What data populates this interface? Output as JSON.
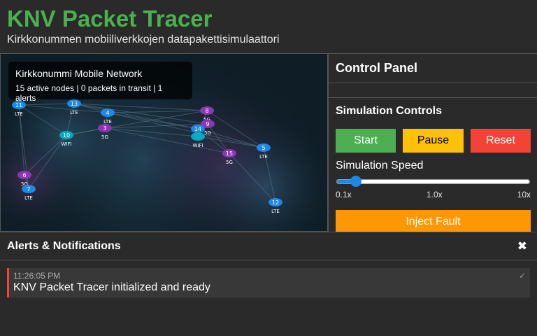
{
  "header": {
    "title": "KNV Packet Tracer",
    "subtitle": "Kirkkonummen mobiiliverkkojen datapakettisimulaattori"
  },
  "network": {
    "info_title": "Kirkkonummi Mobile Network",
    "info_stats": "15 active nodes | 0 packets in transit | 1 alerts",
    "nodes": [
      {
        "id": "11",
        "type": "LTE"
      },
      {
        "id": "13",
        "type": "LTE"
      },
      {
        "id": "4",
        "type": "LTE"
      },
      {
        "id": "3",
        "type": "5G"
      },
      {
        "id": "10",
        "type": "WIFI"
      },
      {
        "id": "8",
        "type": "5G"
      },
      {
        "id": "9",
        "type": "5G"
      },
      {
        "id": "14",
        "type": "LTE"
      },
      {
        "id": "",
        "type": "WIFI"
      },
      {
        "id": "5",
        "type": "LTE"
      },
      {
        "id": "15",
        "type": "5G"
      },
      {
        "id": "6",
        "type": "5G"
      },
      {
        "id": "7",
        "type": "LTE"
      },
      {
        "id": "12",
        "type": "LTE"
      }
    ],
    "colors": {
      "LTE": "#1e88e5",
      "5G": "#8e35b5",
      "WIFI": "#00acc1"
    }
  },
  "control_panel": {
    "title": "Control Panel",
    "simulation_title": "Simulation Controls",
    "start_label": "Start",
    "pause_label": "Pause",
    "reset_label": "Reset",
    "speed_label": "Simulation Speed",
    "speed_min": "0.1x",
    "speed_mid": "1.0x",
    "speed_max": "10x",
    "speed_position": 0.1,
    "fault_label": "Inject Fault"
  },
  "alerts": {
    "title": "Alerts & Notifications",
    "close_icon": "✖",
    "items": [
      {
        "time": "11:26:05 PM",
        "message": "KNV Packet Tracer initialized and ready",
        "ack_icon": "✓"
      }
    ]
  }
}
